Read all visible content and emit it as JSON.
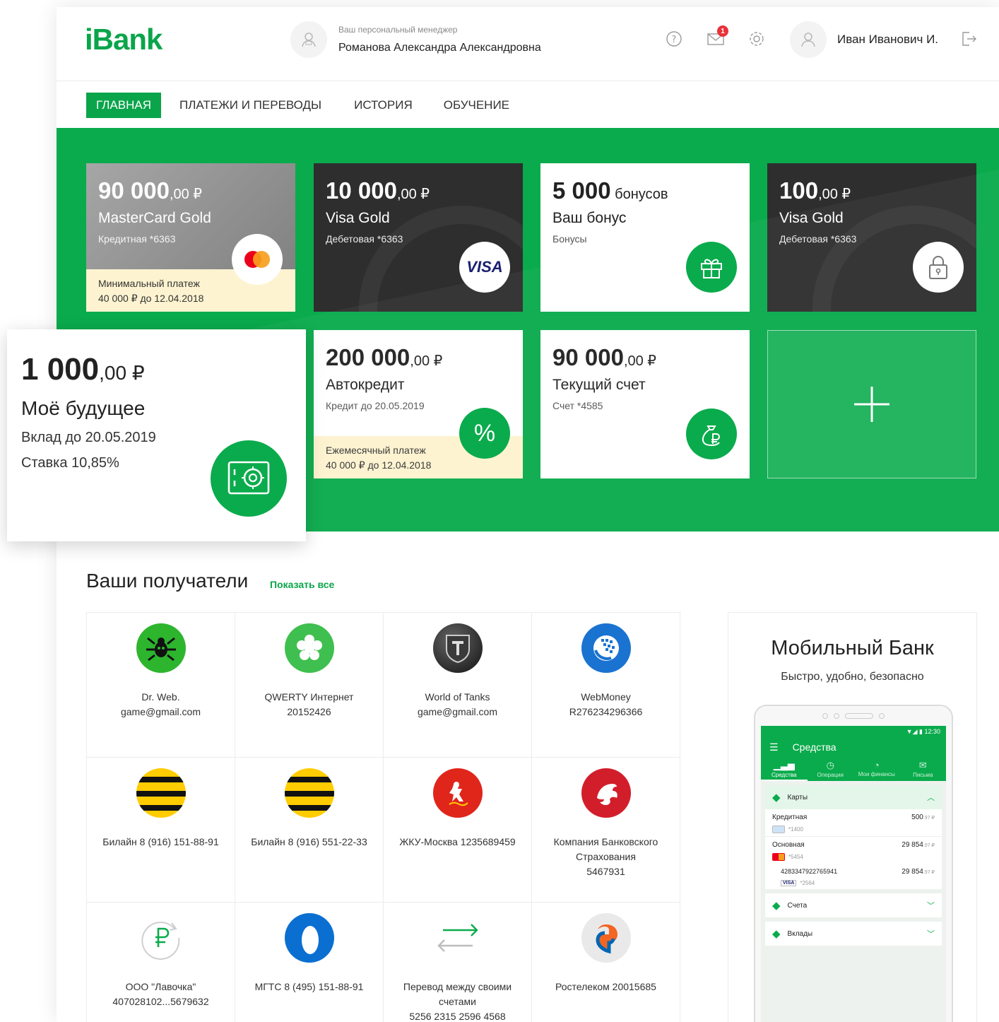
{
  "header": {
    "logo": "iBank",
    "manager_caption": "Ваш персональный менеджер",
    "manager_name": "Романова Александра Александровна",
    "mail_badge": "1",
    "user_name": "Иван Иванович И."
  },
  "nav": {
    "items": [
      {
        "label": "ГЛАВНАЯ",
        "active": true
      },
      {
        "label": "ПЛАТЕЖИ И ПЕРЕВОДЫ"
      },
      {
        "label": "ИСТОРИЯ"
      },
      {
        "label": "ОБУЧЕНИЕ"
      }
    ]
  },
  "cards": [
    {
      "amount": "90 000",
      "cents": ",00 ₽",
      "title": "MasterCard Gold",
      "sub": "Кредитная *6363",
      "note_line1": "Минимальный платеж",
      "note_line2": "40 000 ₽ до 12.04.2018",
      "icon": "mastercard-logo"
    },
    {
      "amount": "10 000",
      "cents": ",00 ₽",
      "title": "Visa Gold",
      "sub": "Дебетовая *6363",
      "icon": "visa-logo",
      "icon_text": "VISA"
    },
    {
      "amount": "5 000",
      "cents": " бонусов",
      "title": "Ваш бонус",
      "sub": "Бонусы",
      "icon": "gift-icon"
    },
    {
      "amount": "100",
      "cents": ",00 ₽",
      "title": "Visa Gold",
      "sub": "Дебетовая *6363",
      "icon": "lock-icon"
    },
    {
      "amount": "200 000",
      "cents": ",00 ₽",
      "title": "Автокредит",
      "sub": "Кредит до 20.05.2019",
      "note_line1": "Ежемесячный платеж",
      "note_line2": "40 000 ₽ до 12.04.2018",
      "icon": "percent-icon",
      "icon_text": "%"
    },
    {
      "amount": "90 000",
      "cents": ",00 ₽",
      "title": "Текущий счет",
      "sub": "Счет *4585",
      "icon": "money-bag-icon"
    }
  ],
  "deposit": {
    "amount": "1 000",
    "cents": ",00 ₽",
    "title": "Моё будущее",
    "sub1": "Вклад до 20.05.2019",
    "sub2": "Ставка 10,85%"
  },
  "recipients": {
    "title": "Ваши получатели",
    "show_all": "Показать все",
    "items": [
      {
        "label": "Dr. Web.\ngame@gmail.com",
        "icon": "drweb-logo"
      },
      {
        "label": "QWERTY Интернет\n20152426",
        "icon": "qwerty-logo"
      },
      {
        "label": "World of Tanks\ngame@gmail.com",
        "icon": "world-of-tanks-logo"
      },
      {
        "label": "WebMoney\nR276234296366",
        "icon": "webmoney-logo"
      },
      {
        "label": "Билайн 8 (916) 151-88-91",
        "icon": "beeline-logo"
      },
      {
        "label": "Билайн 8 (916) 551-22-33",
        "icon": "beeline-logo"
      },
      {
        "label": "ЖКУ-Москва 1235689459",
        "icon": "moscow-coat-of-arms-logo"
      },
      {
        "label": "Компания Банковского\nСтрахования\n5467931",
        "icon": "insurance-bear-logo"
      },
      {
        "label": "ООО \"Лавочка\"\n407028102...5679632",
        "icon": "ruble-transfer-icon"
      },
      {
        "label": "МГТС 8 (495) 151-88-91",
        "icon": "mgts-logo"
      },
      {
        "label": "Перевод между своими\nсчетами\n5256 2315 2596 4568",
        "icon": "transfer-arrows-icon"
      },
      {
        "label": "Ростелеком 20015685",
        "icon": "rostelecom-logo"
      }
    ]
  },
  "mobile_bank": {
    "title": "Мобильный Банк",
    "subtitle": "Быстро, удобно, безопасно",
    "status_time": "12:30",
    "app_title": "Средства",
    "tabs": [
      "Средства",
      "Операции",
      "Мои финансы",
      "Письма"
    ],
    "sections": {
      "cards": "Карты",
      "accounts": "Счета",
      "deposits": "Вклады"
    },
    "rows": [
      {
        "name": "Кредитная",
        "value": "500",
        "cents": ".97 ₽",
        "card": "*1400"
      },
      {
        "name": "Основная",
        "value": "29 854",
        "cents": ".97 ₽",
        "card": "*5454"
      },
      {
        "name": "4283347922765941",
        "value": "29 854",
        "cents": ".97 ₽",
        "card": "*2564",
        "card_brand": "VISA"
      }
    ]
  },
  "colors": {
    "brand_green": "#0aab4c",
    "note_yellow": "#fdf3d0",
    "badge_red": "#e8323b"
  }
}
